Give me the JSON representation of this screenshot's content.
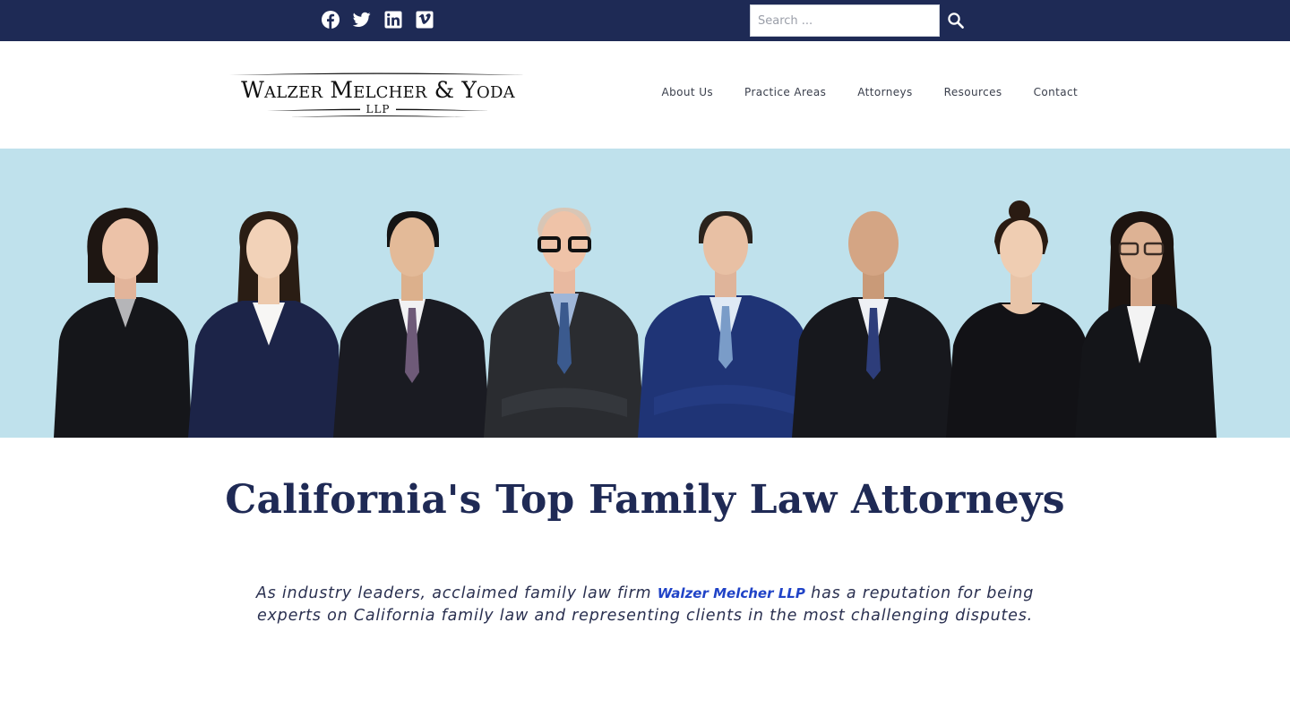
{
  "topbar": {
    "social": [
      {
        "name": "facebook-icon"
      },
      {
        "name": "twitter-icon"
      },
      {
        "name": "linkedin-icon"
      },
      {
        "name": "vimeo-icon"
      }
    ],
    "search": {
      "placeholder": "Search ...",
      "icon": "search-icon"
    }
  },
  "header": {
    "logo": {
      "name": "Walzer Melcher & Yoda",
      "suffix": "LLP"
    },
    "nav": [
      "About Us",
      "Practice Areas",
      "Attorneys",
      "Resources",
      "Contact"
    ]
  },
  "hero": {
    "background": "#bfe1ec",
    "people_count": 8
  },
  "main": {
    "title": "California's Top Family Law Attorneys",
    "intro_before": "As industry leaders, acclaimed family law firm ",
    "intro_link": "Walzer Melcher LLP",
    "intro_after": " has a reputation for being experts on California family law and representing clients in the most challenging disputes."
  },
  "colors": {
    "navy": "#1e2a55",
    "link": "#2043c7",
    "hero_bg": "#bfe1ec"
  }
}
